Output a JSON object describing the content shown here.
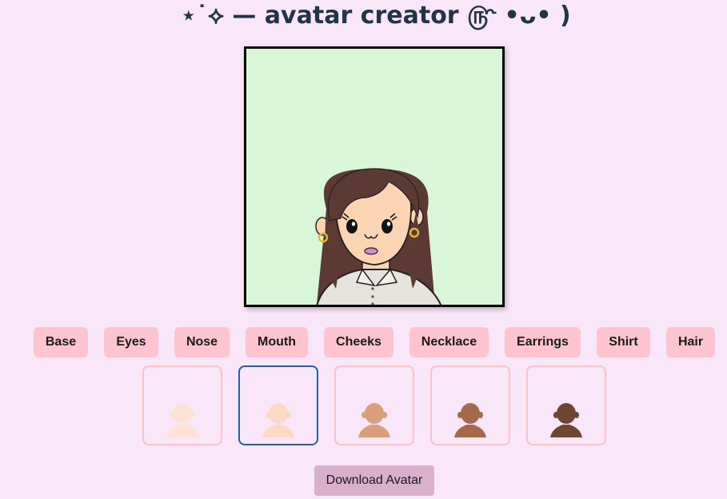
{
  "title": "⋆˙⟡ — avatar creator ௹ •ᴗ• )",
  "tabs": [
    {
      "label": "Base"
    },
    {
      "label": "Eyes"
    },
    {
      "label": "Nose"
    },
    {
      "label": "Mouth"
    },
    {
      "label": "Cheeks"
    },
    {
      "label": "Necklace"
    },
    {
      "label": "Earrings"
    },
    {
      "label": "Shirt"
    },
    {
      "label": "Hair"
    }
  ],
  "base_options": {
    "selected_index": 1,
    "skin_colors": [
      "#fde0c8",
      "#fbd4b4",
      "#d99f7c",
      "#a4694b",
      "#6e4633"
    ]
  },
  "download_label": "Download Avatar",
  "colors": {
    "background": "#fae6f9",
    "canvas_background": "#d9f7d6",
    "tab_background": "#ffc4d0",
    "option_border": "#ffc0cb",
    "option_selected_border": "#1f5fb5",
    "download_background": "#d9b0cc",
    "hair": "#5a3a32",
    "shirt": "#e6e2dc",
    "earring": "#e6b830",
    "title_color": "#213547"
  }
}
